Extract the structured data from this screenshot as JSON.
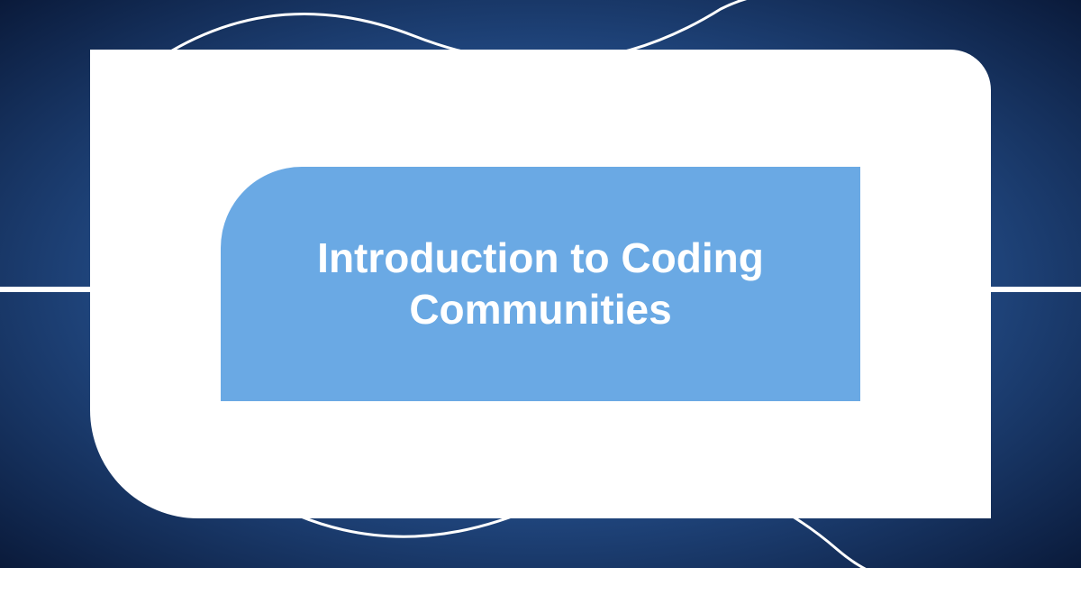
{
  "title": "Introduction to Coding Communities"
}
